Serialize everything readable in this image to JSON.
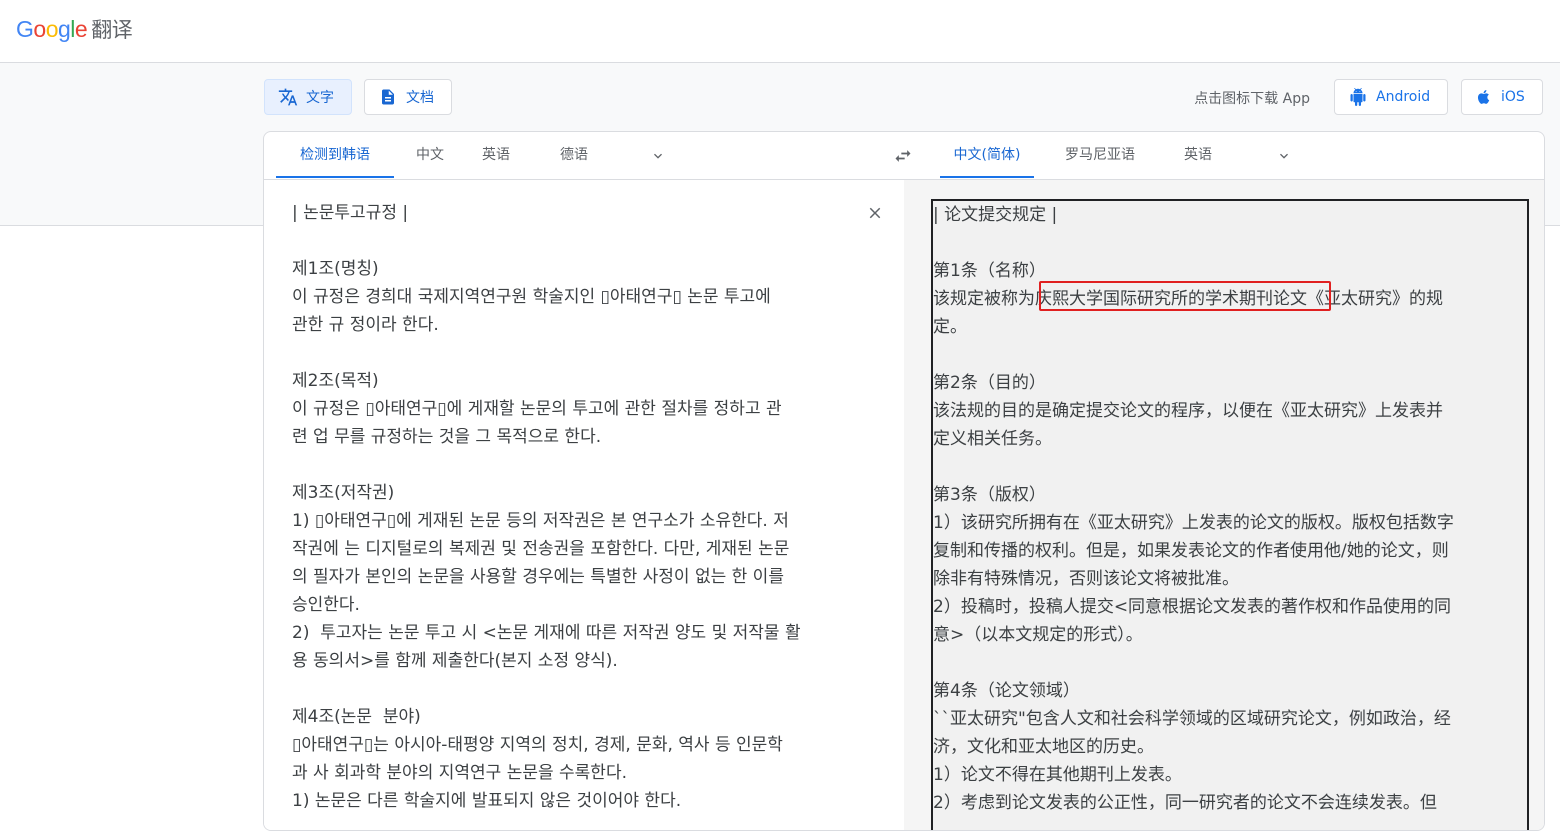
{
  "header": {
    "logo_letters": [
      "G",
      "o",
      "o",
      "g",
      "l",
      "e"
    ],
    "product": "翻译"
  },
  "modes": {
    "text_label": "文字",
    "doc_label": "文档"
  },
  "apps": {
    "prompt": "点击图标下载 App",
    "android_label": "Android",
    "ios_label": "iOS"
  },
  "source_langs": {
    "detected": "检测到韩语",
    "tabs": [
      "中文",
      "英语",
      "德语"
    ]
  },
  "target_langs": {
    "selected": "中文(简体)",
    "tabs": [
      "罗马尼亚语",
      "英语"
    ]
  },
  "source_text": "| 논문투고규정 |\n\n제1조(명칭)\n이 규정은 경희대 국제지역연구원 학술지인 ▯아태연구▯ 논문 투고에\n관한 규 정이라 한다.\n\n제2조(목적)\n이 규정은 ▯아태연구▯에 게재할 논문의 투고에 관한 절차를 정하고 관\n련 업 무를 규정하는 것을 그 목적으로 한다.\n\n제3조(저작권)\n1) ▯아태연구▯에 게재된 논문 등의 저작권은 본 연구소가 소유한다. 저\n작권에 는 디지털로의 복제권 및 전송권을 포함한다. 다만, 게재된 논문\n의 필자가 본인의 논문을 사용할 경우에는 특별한 사정이 없는 한 이를\n승인한다.\n2)  투고자는 논문 투고 시 <논문 게재에 따른 저작권 양도 및 저작물 활\n용 동의서>를 함께 제출한다(본지 소정 양식).\n\n제4조(논문  분야)\n▯아태연구▯는 아시아-태평양 지역의 정치, 경제, 문화, 역사 등 인문학\n과 사 회과학 분야의 지역연구 논문을 수록한다.\n1) 논문은 다른 학술지에 발표되지 않은 것이어야 한다.",
  "target_text": "| 论文提交规定 |\n\n第1条（名称）\n该规定被称为庆熙大学国际研究所的学术期刊论文《亚太研究》的规\n定。\n\n第2条（目的）\n该法规的目的是确定提交论文的程序，以便在《亚太研究》上发表并\n定义相关任务。\n\n第3条（版权）\n1）该研究所拥有在《亚太研究》上发表的论文的版权。版权包括数字\n复制和传播的权利。但是，如果发表论文的作者使用他/她的论文，则\n除非有特殊情况，否则该论文将被批准。\n2）投稿时，投稿人提交<同意根据论文发表的著作权和作品使用的同\n意>（以本文规定的形式）。\n\n第4条（论文领域）\n``亚太研究\"包含人文和社会科学领域的区域研究论文，例如政治，经\n济，文化和亚太地区的历史。\n1）论文不得在其他期刊上发表。\n2）考虑到论文发表的公正性，同一研究者的论文不会连续发表。但",
  "colors": {
    "accent": "#1a73e8",
    "highlight_box": "#e02020"
  },
  "icons": [
    "translate-icon",
    "document-icon",
    "android-icon",
    "apple-icon",
    "chevron-down-icon",
    "swap-icon",
    "close-icon"
  ]
}
